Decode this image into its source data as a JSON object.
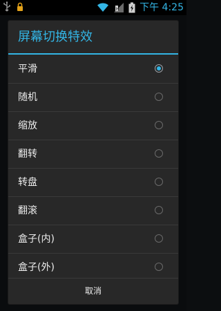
{
  "status_bar": {
    "time": "下午 4:25",
    "icons": [
      "usb-icon",
      "lock-icon",
      "wifi-icon",
      "signal-icon",
      "battery-charging-icon"
    ],
    "accent": "#33b5e5"
  },
  "dialog": {
    "title": "屏幕切换特效",
    "options": [
      {
        "label": "平滑",
        "selected": true
      },
      {
        "label": "随机",
        "selected": false
      },
      {
        "label": "缩放",
        "selected": false
      },
      {
        "label": "翻转",
        "selected": false
      },
      {
        "label": "转盘",
        "selected": false
      },
      {
        "label": "翻滚",
        "selected": false
      },
      {
        "label": "盒子(内)",
        "selected": false
      },
      {
        "label": "盒子(外)",
        "selected": false
      }
    ],
    "cancel_label": "取消",
    "accent": "#33b5e5"
  }
}
